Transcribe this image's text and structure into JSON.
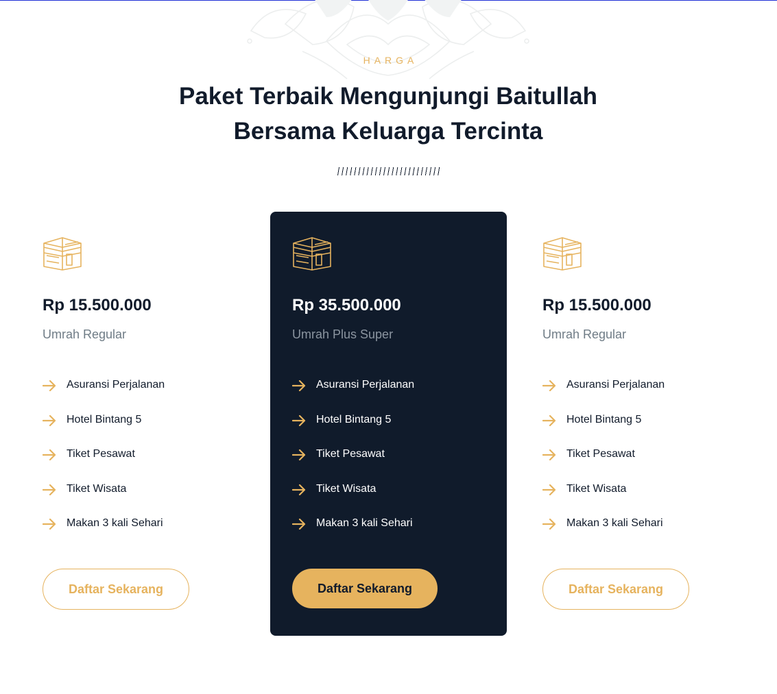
{
  "section": {
    "eyebrow": "HARGA",
    "title_line1": "Paket Terbaik Mengunjungi Baitullah",
    "title_line2": "Bersama Keluarga Tercinta"
  },
  "colors": {
    "accent": "#e6b35e",
    "dark_card": "#101b2b",
    "heading": "#111b2b",
    "muted": "#6f7c86"
  },
  "icons": {
    "package": "kaaba-icon",
    "feature": "arrow-right-icon",
    "ornament": "mandala-ornament"
  },
  "plans": [
    {
      "price": "Rp 15.500.000",
      "name": "Umrah Regular",
      "features": [
        "Asuransi Perjalanan",
        "Hotel Bintang 5",
        "Tiket Pesawat",
        "Tiket Wisata",
        "Makan 3 kali Sehari"
      ],
      "cta": "Daftar Sekarang"
    },
    {
      "price": "Rp 35.500.000",
      "name": "Umrah Plus Super",
      "features": [
        "Asuransi Perjalanan",
        "Hotel Bintang 5",
        "Tiket Pesawat",
        "Tiket Wisata",
        "Makan 3 kali Sehari"
      ],
      "cta": "Daftar Sekarang"
    },
    {
      "price": "Rp 15.500.000",
      "name": "Umrah Regular",
      "features": [
        "Asuransi Perjalanan",
        "Hotel Bintang 5",
        "Tiket Pesawat",
        "Tiket Wisata",
        "Makan 3 kali Sehari"
      ],
      "cta": "Daftar Sekarang"
    }
  ]
}
